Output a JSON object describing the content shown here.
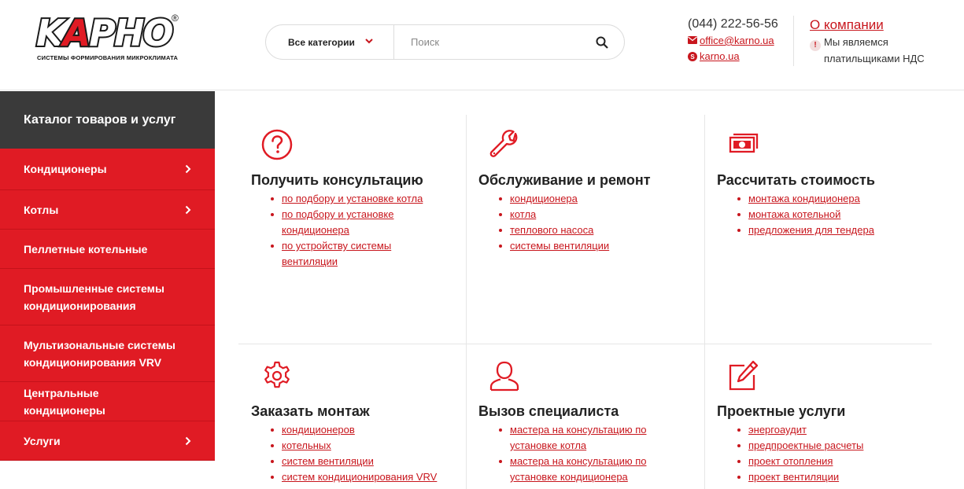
{
  "logo": {
    "wordmark_left": "K",
    "wordmark_red": "A",
    "wordmark_right": "PHO",
    "registered": "®",
    "tagline": "СИСТЕМЫ ФОРМИРОВАНИЯ МИКРОКЛИМАТА"
  },
  "search": {
    "category_label": "Все категории",
    "placeholder": "Поиск",
    "search_icon": "search-icon",
    "chevron_icon": "chevron-down-icon"
  },
  "contacts": {
    "phone": "(044) 222-56-56",
    "email": "office@karno.ua",
    "skype": "karno.ua"
  },
  "about_link": "О компании",
  "vat_notice": {
    "line1": "Мы являемся",
    "line2": "платильщиками НДС"
  },
  "sidebar": {
    "title": "Каталог товаров и услуг",
    "items": [
      {
        "label": "Кондиционеры",
        "has_arrow": true
      },
      {
        "label": "Котлы",
        "has_arrow": true
      },
      {
        "label": "Пеллетные котельные",
        "has_arrow": false
      },
      {
        "label": "Промышленные системы кондиционирования",
        "has_arrow": false
      },
      {
        "label": "Мультизональные системы кондиционирования VRV",
        "has_arrow": false
      },
      {
        "label": "Центральные кондиционеры",
        "has_arrow": false
      },
      {
        "label": "Услуги",
        "has_arrow": true
      }
    ]
  },
  "services": [
    {
      "icon": "question-icon",
      "title": "Получить консультацию",
      "links": [
        "по подбору и установке котла",
        "по подбору и установке кондиционера",
        "по устройству системы вентиляции"
      ]
    },
    {
      "icon": "wrench-icon",
      "title": "Обслуживание и ремонт",
      "links": [
        "кондиционера",
        "котла",
        "теплового насоса",
        "системы вентиляции"
      ]
    },
    {
      "icon": "money-icon",
      "title": "Рассчитать стоимость",
      "links": [
        "монтажа кондиционера",
        "монтажа котельной",
        "предложения для тендера"
      ]
    },
    {
      "icon": "gear-icon",
      "title": "Заказать монтаж",
      "links": [
        "кондиционеров",
        "котельных",
        "систем вентиляции",
        "систем кондиционирования VRV"
      ]
    },
    {
      "icon": "user-icon",
      "title": "Вызов специалиста",
      "links": [
        "мастера на консультацию по установке котла",
        "мастера на консультацию по установке кондиционера"
      ]
    },
    {
      "icon": "edit-icon",
      "title": "Проектные услуги",
      "links": [
        "энергоаудит",
        "предпроектные расчеты",
        "проект отопления",
        "проект вентиляции"
      ]
    }
  ],
  "colors": {
    "accent": "#e01b24",
    "link": "#c8161d",
    "sidebar_head": "#3a3a3a"
  }
}
